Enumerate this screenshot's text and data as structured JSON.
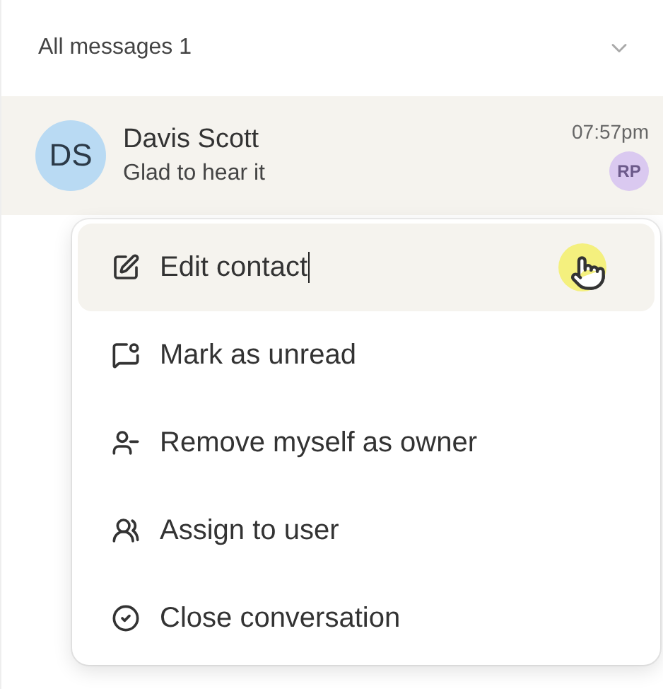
{
  "header": {
    "title": "All messages 1"
  },
  "conversation": {
    "initials": "DS",
    "name": "Davis Scott",
    "preview": "Glad to hear it",
    "time": "07:57pm",
    "owner_initials": "RP"
  },
  "menu": [
    {
      "kind": "edit",
      "label": "Edit contact",
      "selected": true
    },
    {
      "kind": "unread",
      "label": "Mark as unread",
      "selected": false
    },
    {
      "kind": "remove",
      "label": "Remove myself as owner",
      "selected": false
    },
    {
      "kind": "assign",
      "label": "Assign to user",
      "selected": false
    },
    {
      "kind": "close",
      "label": "Close conversation",
      "selected": false
    }
  ]
}
